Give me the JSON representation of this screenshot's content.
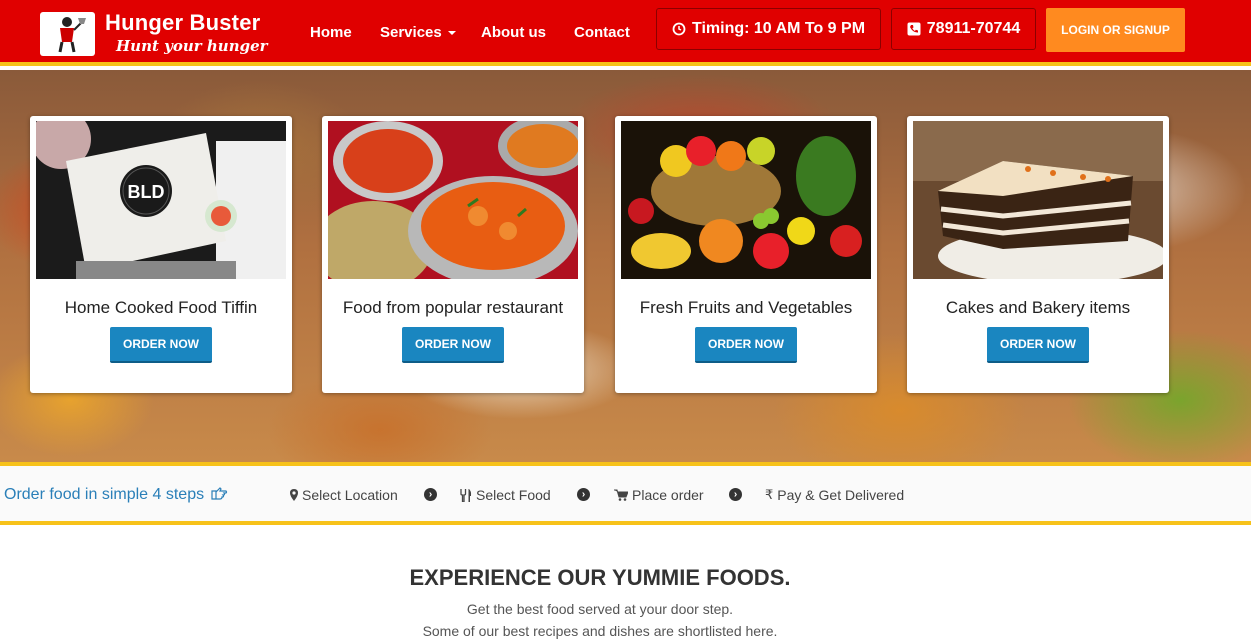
{
  "header": {
    "brand_name": "Hunger Buster",
    "brand_tagline": "Hunt your hunger",
    "logo_icon": "chef-logo-icon",
    "nav": [
      {
        "label": "Home"
      },
      {
        "label": "Services"
      },
      {
        "label": "About us"
      },
      {
        "label": "Contact"
      }
    ],
    "timing": "Timing: 10 AM To 9 PM",
    "phone": "78911-70744",
    "login_label": "LOGIN OR SIGNUP",
    "colors": {
      "bar": "#e00000",
      "accent_border": "#f7c21a",
      "login_button": "#ff8a1f"
    }
  },
  "cards": [
    {
      "title": "Home Cooked Food Tiffin",
      "button": "ORDER NOW",
      "image": "tiffin-box-image",
      "box_label": "BLD"
    },
    {
      "title": "Food from popular restaurant",
      "button": "ORDER NOW",
      "image": "restaurant-curry-image"
    },
    {
      "title": "Fresh Fruits and Vegetables",
      "button": "ORDER NOW",
      "image": "fruit-basket-image"
    },
    {
      "title": "Cakes and Bakery items",
      "button": "ORDER NOW",
      "image": "cake-image"
    }
  ],
  "steps": {
    "title": "Order food in simple 4 steps",
    "items": [
      {
        "label": "Select Location",
        "icon": "map-marker-icon"
      },
      {
        "label": "Select Food",
        "icon": "cutlery-icon"
      },
      {
        "label": "Place order",
        "icon": "cart-icon"
      },
      {
        "label": "Pay & Get Delivered",
        "icon": "rupee-icon"
      }
    ]
  },
  "experience": {
    "title": "EXPERIENCE OUR YUMMIE FOODS.",
    "line1": "Get the best food served at your door step.",
    "line2": "Some of our best recipes and dishes are shortlisted here."
  }
}
